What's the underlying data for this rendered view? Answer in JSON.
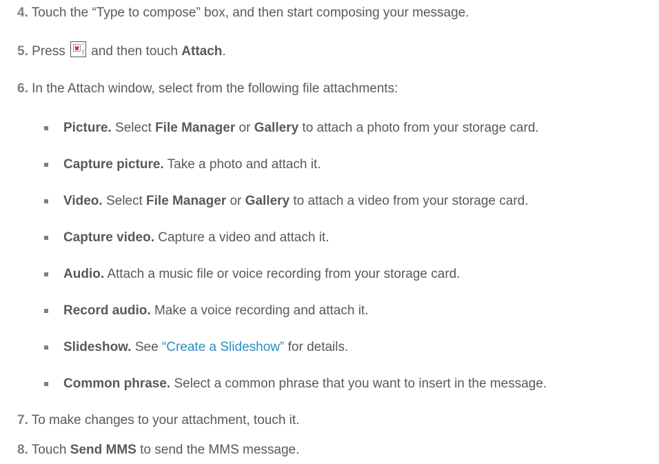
{
  "steps": {
    "s4": {
      "num": "4.",
      "text": "Touch the “Type to compose” box, and then start composing your message."
    },
    "s5": {
      "num": "5.",
      "press": "Press",
      "and_then": "and then touch",
      "attach": "Attach",
      "period": ".",
      "icon": "menu-key-icon"
    },
    "s6": {
      "num": "6.",
      "text": "In the Attach window, select from the following file attachments:"
    },
    "s7": {
      "num": "7.",
      "text": "To make changes to your attachment, touch it."
    },
    "s8": {
      "num": "8.",
      "touch": "Touch",
      "send_mms": "Send MMS",
      "rest": "to send the MMS message."
    }
  },
  "attachments": {
    "picture": {
      "title": "Picture.",
      "select": "Select",
      "file_manager": "File Manager",
      "or": "or",
      "gallery": "Gallery",
      "rest": "to attach a photo from your storage card."
    },
    "capture_picture": {
      "title": "Capture picture.",
      "text": "Take a photo and attach it."
    },
    "video": {
      "title": "Video.",
      "select": "Select",
      "file_manager": "File Manager",
      "or": "or",
      "gallery": "Gallery",
      "rest": "to attach a video from your storage card."
    },
    "capture_video": {
      "title": "Capture video.",
      "text": "Capture a video and attach it."
    },
    "audio": {
      "title": "Audio.",
      "text": "Attach a music file or voice recording from your storage card."
    },
    "record_audio": {
      "title": "Record audio.",
      "text": "Make a voice recording and attach it."
    },
    "slideshow": {
      "title": "Slideshow.",
      "see": "See",
      "link_text": "“Create a Slideshow”",
      "rest": "for details."
    },
    "common_phrase": {
      "title": "Common phrase.",
      "text": "Select a common phrase that you want to insert in the message."
    }
  },
  "colors": {
    "text": "#595959",
    "step_number": "#7f7f7f",
    "link": "#2b8fc0"
  }
}
